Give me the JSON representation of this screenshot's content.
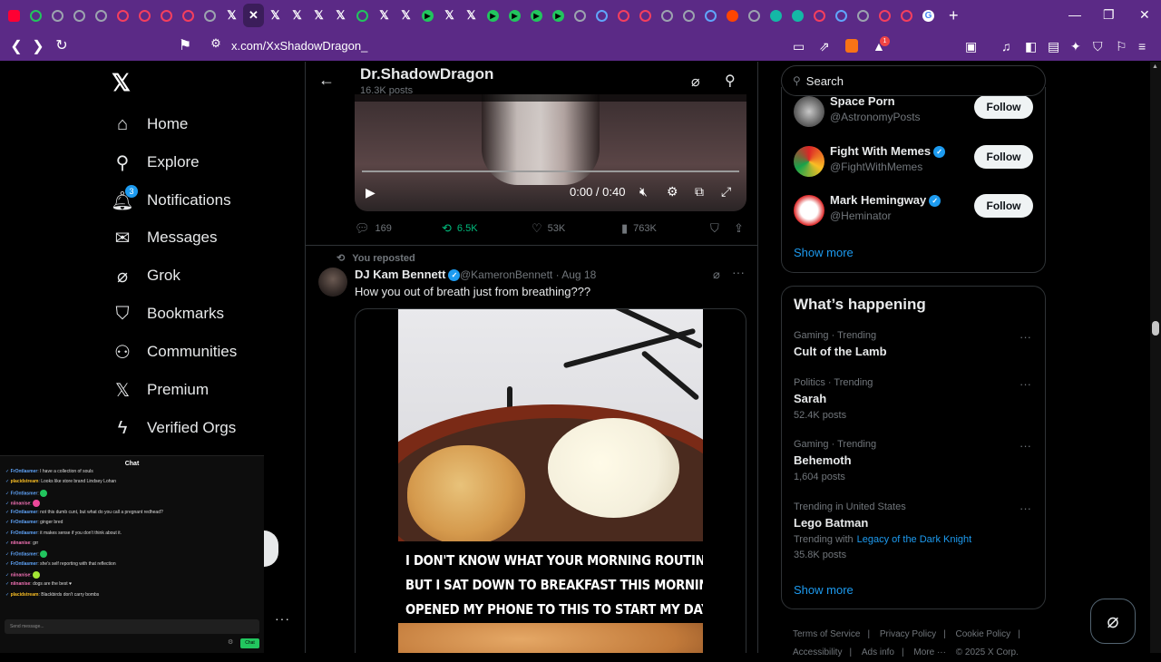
{
  "browser": {
    "url": "x.com/XxShadowDragon_",
    "notification_count": "1",
    "new_tab_symbol": "+",
    "window_controls": {
      "minimize": "—",
      "maximize": "❐",
      "close": "✕"
    }
  },
  "nav": {
    "items": [
      {
        "label": "Home"
      },
      {
        "label": "Explore"
      },
      {
        "label": "Notifications",
        "badge": "3"
      },
      {
        "label": "Messages"
      },
      {
        "label": "Grok"
      },
      {
        "label": "Bookmarks"
      },
      {
        "label": "Communities"
      },
      {
        "label": "Premium"
      },
      {
        "label": "Verified Orgs"
      }
    ]
  },
  "chat": {
    "title": "Chat",
    "input_placeholder": "Send message...",
    "send_label": "Chat",
    "messages": [
      {
        "user": "FrOntlasmer",
        "text": "I have a collection of souls",
        "color": "#60a5fa"
      },
      {
        "user": "placidstream",
        "text": "Looks like store brand Lindsey Lohan",
        "color": "#fbbf24"
      },
      {
        "user": "FrOntlasmer",
        "text": "",
        "color": "#60a5fa",
        "emote": "#22c55e"
      },
      {
        "user": "niinanise",
        "text": "",
        "color": "#f472b6",
        "emote": "#ec4899"
      },
      {
        "user": "FrOntlasmer",
        "text": "not this dumb cunt, but what do you call a pregnant redhead?",
        "color": "#60a5fa"
      },
      {
        "user": "FrOntlasmer",
        "text": "ginger bred",
        "color": "#60a5fa"
      },
      {
        "user": "FrOntlasmer",
        "text": "it makes sense if you don't think about it.",
        "color": "#60a5fa"
      },
      {
        "user": "niinanise",
        "text": "grr",
        "color": "#f472b6"
      },
      {
        "user": "FrOntlasmer",
        "text": "",
        "color": "#60a5fa",
        "emote": "#22c55e"
      },
      {
        "user": "FrOntlasmer",
        "text": "she's self reporting with that reflection",
        "color": "#60a5fa"
      },
      {
        "user": "niinanise",
        "text": "",
        "color": "#f472b6",
        "emote": "#a3e635"
      },
      {
        "user": "niinanise",
        "text": "dogs are the best ♥",
        "color": "#f472b6"
      },
      {
        "user": "placidstream",
        "text": "Blackbirds don't carry bombs",
        "color": "#fbbf24"
      }
    ]
  },
  "profile": {
    "name": "Dr.ShadowDragon",
    "posts_count": "16.3K posts"
  },
  "video": {
    "time": "0:00 / 0:40",
    "progress": 0.0
  },
  "post1_actions": {
    "replies": "169",
    "reposts": "6.5K",
    "likes": "53K",
    "views": "763K"
  },
  "post2": {
    "repost_note": "You reposted",
    "author": "DJ Kam Bennett",
    "handle": "@KameronBennett · Aug 18",
    "text": "How you out of breath just from breathing???",
    "caption_lines": [
      "I DON'T KNOW WHAT YOUR MORNING ROUTINE IS",
      "BUT I SAT DOWN TO BREAKFAST THIS MORNING &",
      "OPENED MY PHONE TO THIS TO START MY DAY"
    ]
  },
  "right": {
    "search_placeholder": "Search",
    "who_to_follow": [
      {
        "name": "Space Porn",
        "handle": "@AstronomyPosts",
        "verified": false,
        "button": "Follow"
      },
      {
        "name": "Fight With Memes",
        "handle": "@FightWithMemes",
        "verified": true,
        "button": "Follow"
      },
      {
        "name": "Mark Hemingway",
        "handle": "@Heminator",
        "verified": true,
        "button": "Follow"
      }
    ],
    "show_more": "Show more",
    "trends_title": "What’s happening",
    "trends": [
      {
        "category": "Gaming · Trending",
        "name": "Cult of the Lamb",
        "count": ""
      },
      {
        "category": "Politics · Trending",
        "name": "Sarah",
        "count": "52.4K posts"
      },
      {
        "category": "Gaming · Trending",
        "name": "Behemoth",
        "count": "1,604 posts"
      },
      {
        "category": "Trending in United States",
        "name": "Lego Batman",
        "with_label": "Trending with",
        "with_link": "Legacy of the Dark Knight",
        "count": "35.8K posts"
      }
    ],
    "trends_show_more": "Show more",
    "footer": {
      "terms": "Terms of Service",
      "privacy": "Privacy Policy",
      "cookie": "Cookie Policy",
      "accessibility": "Accessibility",
      "ads": "Ads info",
      "more": "More ···",
      "copyright": "© 2025 X Corp."
    }
  }
}
